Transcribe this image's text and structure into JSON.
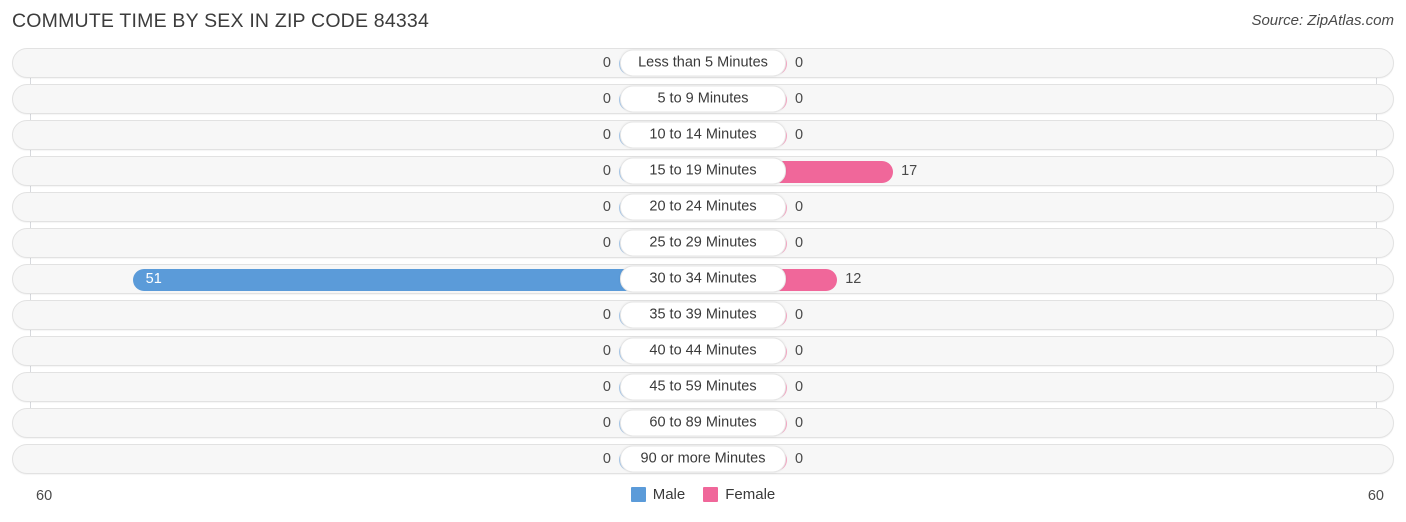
{
  "header": {
    "title": "COMMUTE TIME BY SEX IN ZIP CODE 84334",
    "source": "Source: ZipAtlas.com"
  },
  "legend": {
    "male_label": "Male",
    "female_label": "Female",
    "male_color": "#5b9bd9",
    "female_color": "#f0679a",
    "male_zero_color": "#a9c9ea",
    "female_zero_color": "#f7a9c6"
  },
  "axis": {
    "left_label": "60",
    "right_label": "60",
    "max": 60
  },
  "chart_data": {
    "type": "bar",
    "title": "COMMUTE TIME BY SEX IN ZIP CODE 84334",
    "xlabel": "",
    "ylabel": "",
    "orientation": "horizontal-diverging",
    "grid": false,
    "legend_position": "bottom-center",
    "xlim": [
      -60,
      60
    ],
    "axis_tick_labels": [
      "60",
      "60"
    ],
    "categories": [
      "Less than 5 Minutes",
      "5 to 9 Minutes",
      "10 to 14 Minutes",
      "15 to 19 Minutes",
      "20 to 24 Minutes",
      "25 to 29 Minutes",
      "30 to 34 Minutes",
      "35 to 39 Minutes",
      "40 to 44 Minutes",
      "45 to 59 Minutes",
      "60 to 89 Minutes",
      "90 or more Minutes"
    ],
    "series": [
      {
        "name": "Male",
        "color": "#5b9bd9",
        "values": [
          0,
          0,
          0,
          0,
          0,
          0,
          51,
          0,
          0,
          0,
          0,
          0
        ]
      },
      {
        "name": "Female",
        "color": "#f0679a",
        "values": [
          0,
          0,
          0,
          17,
          0,
          0,
          12,
          0,
          0,
          0,
          0,
          0
        ]
      }
    ]
  },
  "rows": [
    {
      "label": "Less than 5 Minutes",
      "male": "0",
      "female": "0"
    },
    {
      "label": "5 to 9 Minutes",
      "male": "0",
      "female": "0"
    },
    {
      "label": "10 to 14 Minutes",
      "male": "0",
      "female": "0"
    },
    {
      "label": "15 to 19 Minutes",
      "male": "0",
      "female": "17"
    },
    {
      "label": "20 to 24 Minutes",
      "male": "0",
      "female": "0"
    },
    {
      "label": "25 to 29 Minutes",
      "male": "0",
      "female": "0"
    },
    {
      "label": "30 to 34 Minutes",
      "male": "51",
      "female": "12"
    },
    {
      "label": "35 to 39 Minutes",
      "male": "0",
      "female": "0"
    },
    {
      "label": "40 to 44 Minutes",
      "male": "0",
      "female": "0"
    },
    {
      "label": "45 to 59 Minutes",
      "male": "0",
      "female": "0"
    },
    {
      "label": "60 to 89 Minutes",
      "male": "0",
      "female": "0"
    },
    {
      "label": "90 or more Minutes",
      "male": "0",
      "female": "0"
    }
  ]
}
